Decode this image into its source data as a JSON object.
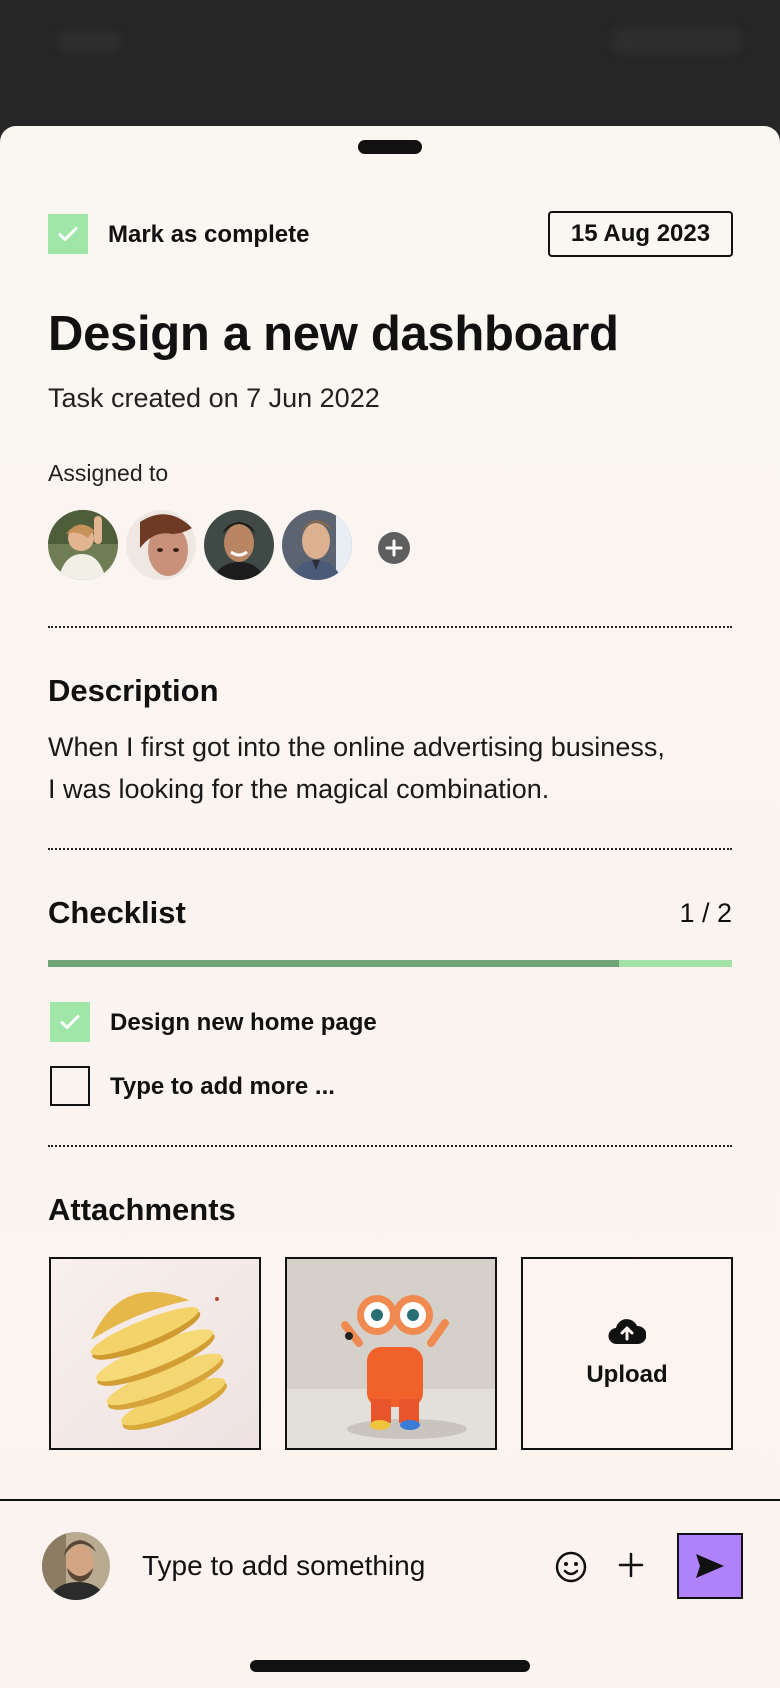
{
  "header": {
    "mark_complete_label": "Mark as complete",
    "mark_complete_checked": true,
    "due_date": "15 Aug 2023"
  },
  "task": {
    "title": "Design a new dashboard",
    "created": "Task created on 7 Jun 2022"
  },
  "assignees": {
    "label": "Assigned to",
    "people": [
      "avatar-1",
      "avatar-2",
      "avatar-3",
      "avatar-4"
    ],
    "add_icon": "plus-circle-icon"
  },
  "description": {
    "title": "Description",
    "line1": "When I first got into the online advertising business,",
    "line2": "I was looking for the magical combination."
  },
  "checklist": {
    "title": "Checklist",
    "count": "1 / 2",
    "progress": 0.835,
    "items": [
      {
        "label": "Design new home page",
        "checked": true
      },
      {
        "label": "Type to add more ...",
        "checked": false
      }
    ]
  },
  "attachments": {
    "title": "Attachments",
    "items": [
      "sliced-mango-image",
      "cartoon-character-image"
    ],
    "upload_label": "Upload",
    "upload_icon": "cloud-upload-icon"
  },
  "composer": {
    "placeholder": "Type to add something",
    "emoji_icon": "emoji-icon",
    "plus_icon": "plus-icon",
    "send_icon": "send-icon"
  },
  "colors": {
    "check_green": "#9fe6a8",
    "progress_fill": "#6fa276",
    "progress_track": "#a4e3a8",
    "send_purple": "#b082fb",
    "background": "#faf6f1"
  }
}
